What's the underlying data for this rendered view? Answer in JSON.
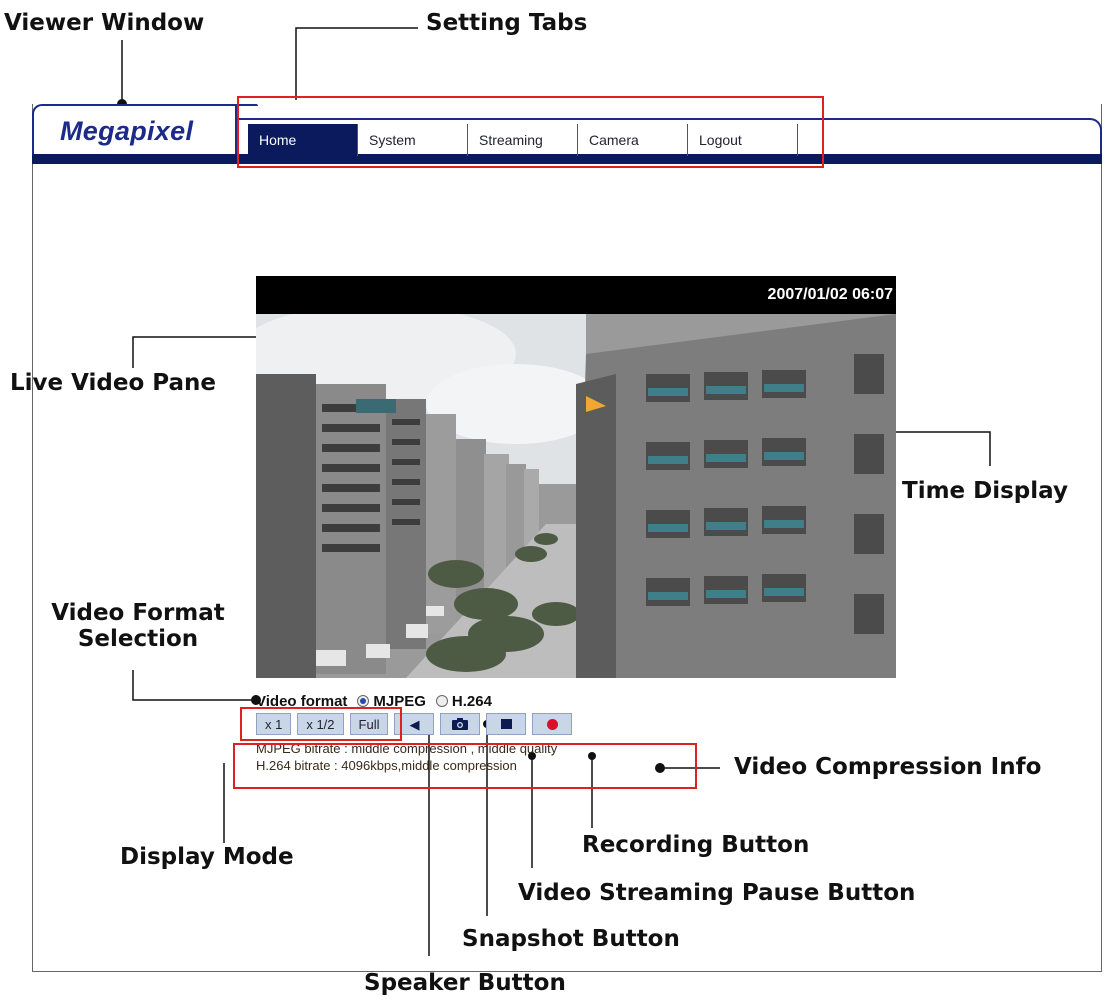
{
  "callouts": {
    "viewer_window": "Viewer Window",
    "setting_tabs": "Setting Tabs",
    "live_video_pane": "Live Video Pane",
    "time_display": "Time Display",
    "video_format_selection_line1": "Video Format",
    "video_format_selection_line2": "Selection",
    "video_compression_info": "Video Compression Info",
    "display_mode": "Display Mode",
    "recording_button": "Recording Button",
    "pause_button": "Video Streaming Pause Button",
    "snapshot_button": "Snapshot Button",
    "speaker_button": "Speaker Button"
  },
  "viewer": {
    "logo": "Megapixel",
    "tabs": [
      {
        "label": "Home"
      },
      {
        "label": "System"
      },
      {
        "label": "Streaming"
      },
      {
        "label": "Camera"
      },
      {
        "label": "Logout"
      }
    ],
    "timestamp": "2007/01/02 06:07",
    "video_format": {
      "label": "Video format",
      "options": [
        "MJPEG",
        "H.264"
      ],
      "selected": "MJPEG"
    },
    "display_modes": [
      "x 1",
      "x 1/2",
      "Full"
    ],
    "controls": {
      "speaker_icon": "speaker-icon",
      "snapshot_icon": "camera-icon",
      "pause_icon": "pause-icon",
      "record_icon": "record-icon"
    },
    "info": {
      "mjpeg": "MJPEG bitrate : middle compression , middle quality",
      "h264": "H.264 bitrate : 4096kbps,middle compression"
    },
    "colors": {
      "nav": "#0a1a5c",
      "highlight_box": "#e02020",
      "record": "#d8102a"
    }
  }
}
